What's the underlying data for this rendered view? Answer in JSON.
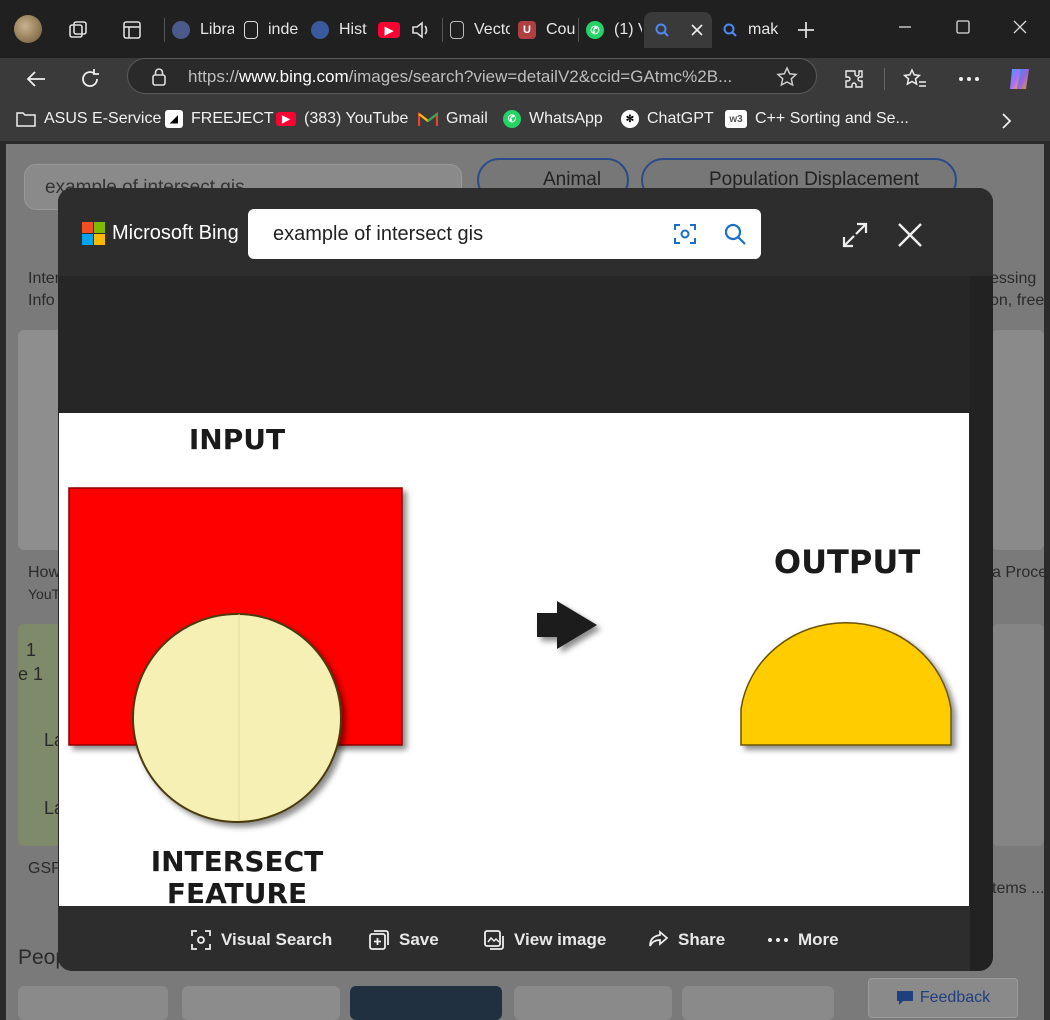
{
  "tabs": [
    {
      "label": "Libra",
      "icon": "library-icon"
    },
    {
      "label": "inde",
      "icon": "document-icon"
    },
    {
      "label": "Hist",
      "icon": "history-icon"
    },
    {
      "label": "",
      "icon": "youtube-audio-tab"
    },
    {
      "label": "Vecto",
      "icon": "document-icon"
    },
    {
      "label": "Cou",
      "icon": "course-icon"
    },
    {
      "label": "(1) V",
      "icon": "whatsapp-icon"
    },
    {
      "label": "",
      "icon": "bing-search-icon"
    },
    {
      "label": "mak",
      "icon": "bing-search-icon"
    }
  ],
  "address_bar": {
    "url_prefix": "https://",
    "url_host": "www.bing.com",
    "url_rest": "/images/search?view=detailV2&ccid=GAtmc%2B..."
  },
  "bookmarks": [
    {
      "label": "ASUS E-Service"
    },
    {
      "label": "FREEJECT"
    },
    {
      "label": "(383) YouTube"
    },
    {
      "label": "Gmail"
    },
    {
      "label": "WhatsApp"
    },
    {
      "label": "ChatGPT"
    },
    {
      "label": "C++ Sorting and Se..."
    }
  ],
  "background_page": {
    "search_text": "example of intersect gis",
    "chips": [
      "Animal",
      "Population Displacement"
    ],
    "snippets": {
      "left1": "Inter",
      "left2": "Info",
      "left3": "How",
      "left4": "YouT",
      "left5": "GSP",
      "left6": "1",
      "left7": "e 1",
      "left8": "La",
      "left9": "La",
      "right1": "essing",
      "right2": "on, free",
      "right3": "a Proce",
      "right4": "tems ...",
      "people": "Peop"
    },
    "feedback": "Feedback"
  },
  "modal": {
    "brand": "Microsoft Bing",
    "query": "example of intersect gis",
    "image": {
      "input_label": "INPUT",
      "output_label": "OUTPUT",
      "intersect_label_line1": "INTERSECT",
      "intersect_label_line2": "FEATURE"
    },
    "actions": [
      {
        "label": "Visual Search",
        "icon": "visual-search-icon"
      },
      {
        "label": "Save",
        "icon": "save-icon"
      },
      {
        "label": "View image",
        "icon": "view-image-icon"
      },
      {
        "label": "Share",
        "icon": "share-icon"
      },
      {
        "label": "More",
        "icon": "more-icon"
      }
    ]
  },
  "colors": {
    "input_square": "#ff0000",
    "intersect_circle": "#f7f0b4",
    "output_shape": "#ffcc00",
    "accent": "#2e6fd6"
  }
}
